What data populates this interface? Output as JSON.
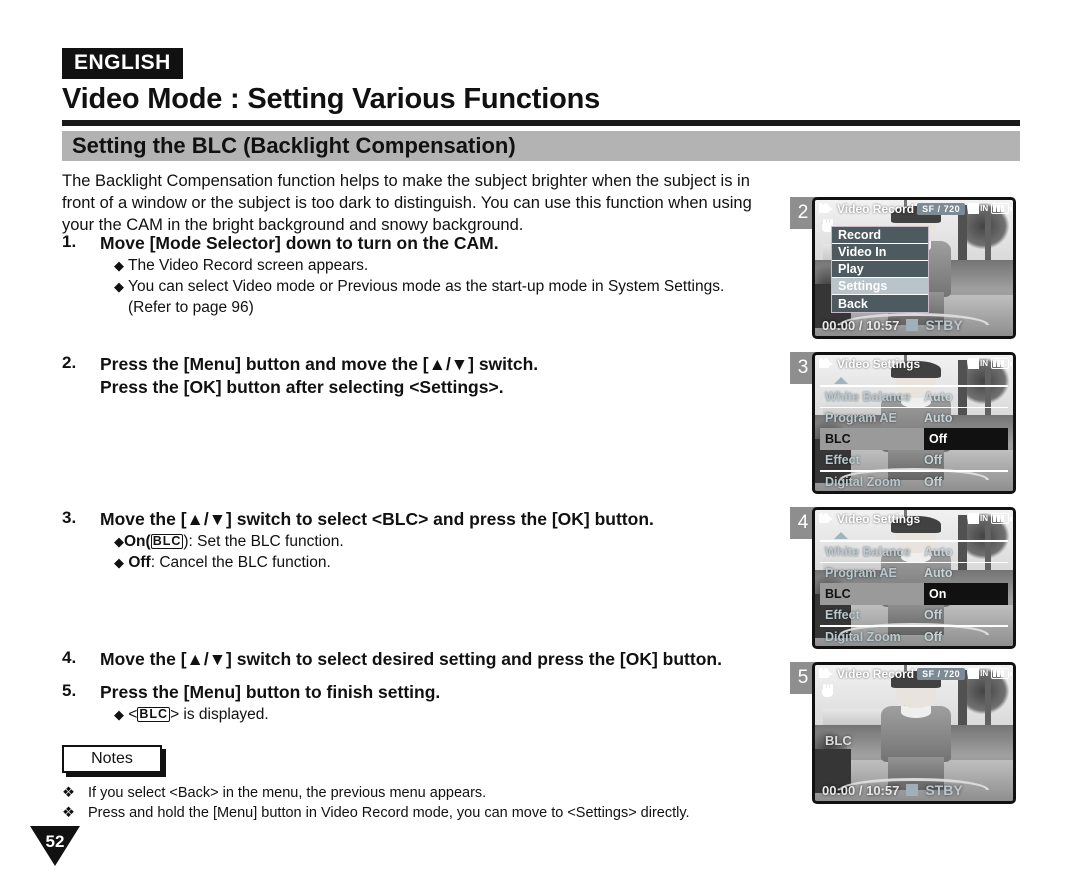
{
  "header": {
    "language_badge": "ENGLISH",
    "title": "Video Mode : Setting Various Functions",
    "subtitle": "Setting the BLC (Backlight Compensation)"
  },
  "intro": "The Backlight Compensation function helps to make the subject brighter when the subject is in front of a window or the subject is too dark to distinguish. You can use this function when using your the CAM in the bright background and snowy background.",
  "steps": [
    {
      "number": "1.",
      "heading": "Move [Mode Selector] down to turn on the CAM.",
      "bullets": [
        "The Video Record screen appears.",
        "You can select Video mode or Previous mode as the start-up mode in System Settings."
      ],
      "continuation": "(Refer to page 96)"
    },
    {
      "number": "2.",
      "heading_line1": "Press the [Menu] button and move the [▲/▼] switch.",
      "heading_line2": "Press the [OK] button after selecting <Settings>."
    },
    {
      "number": "3.",
      "heading": "Move the [▲/▼] switch to select <BLC> and press the [OK] button.",
      "bullet_on_prefix": "On(",
      "bullet_on_glyph": "BLC",
      "bullet_on_suffix": "): Set the BLC function.",
      "bullet_off_prefix": "Off",
      "bullet_off_suffix": ": Cancel the BLC function."
    },
    {
      "number": "4.",
      "heading": "Move the [▲/▼] switch to select desired setting and press the [OK] button."
    },
    {
      "number": "5.",
      "heading": "Press the [Menu] button to finish setting.",
      "bullet_prefix": "<",
      "bullet_glyph": "BLC",
      "bullet_suffix": "> is displayed."
    }
  ],
  "notes": {
    "label": "Notes",
    "items": [
      "If you select <Back> in the menu, the previous menu appears.",
      "Press and hold the [Menu] button in Video Record mode, you can move to <Settings> directly."
    ],
    "mark": "❖"
  },
  "page_number": "52",
  "figures": [
    {
      "badge": "2",
      "osd_title": "Video Record",
      "quality_badge": "SF  /  720",
      "in_label": "IN",
      "timecode": "00:00 / 10:57",
      "status": "STBY",
      "menu": [
        {
          "label": "Record",
          "selected": false
        },
        {
          "label": "Video In",
          "selected": false
        },
        {
          "label": "Play",
          "selected": false
        },
        {
          "label": "Settings",
          "selected": true
        },
        {
          "label": "Back",
          "selected": false
        }
      ]
    },
    {
      "badge": "3",
      "osd_title": "Video Settings",
      "in_label": "IN",
      "rows": [
        {
          "label": "White Balance",
          "value": "Auto",
          "highlighted": false
        },
        {
          "label": "Program AE",
          "value": "Auto",
          "highlighted": false
        },
        {
          "label": "BLC",
          "value": "Off",
          "highlighted": true
        },
        {
          "label": "Effect",
          "value": "Off",
          "highlighted": false
        },
        {
          "label": "Digital Zoom",
          "value": "Off",
          "highlighted": false
        }
      ]
    },
    {
      "badge": "4",
      "osd_title": "Video Settings",
      "in_label": "IN",
      "rows": [
        {
          "label": "White Balance",
          "value": "Auto",
          "highlighted": false
        },
        {
          "label": "Program AE",
          "value": "Auto",
          "highlighted": false
        },
        {
          "label": "BLC",
          "value": "On",
          "highlighted": true
        },
        {
          "label": "Effect",
          "value": "Off",
          "highlighted": false
        },
        {
          "label": "Digital Zoom",
          "value": "Off",
          "highlighted": false
        }
      ]
    },
    {
      "badge": "5",
      "osd_title": "Video Record",
      "quality_badge": "SF  /  720",
      "in_label": "IN",
      "blc_indicator": "BLC",
      "timecode": "00:00 / 10:57",
      "status": "STBY"
    }
  ],
  "colors": {
    "band": "#b3b3b3",
    "badge_bg": "#8e8e8e",
    "menu_item": "#4d5a60",
    "menu_selected": "#b8c4c9",
    "osd_text": "#b9c9cf"
  }
}
